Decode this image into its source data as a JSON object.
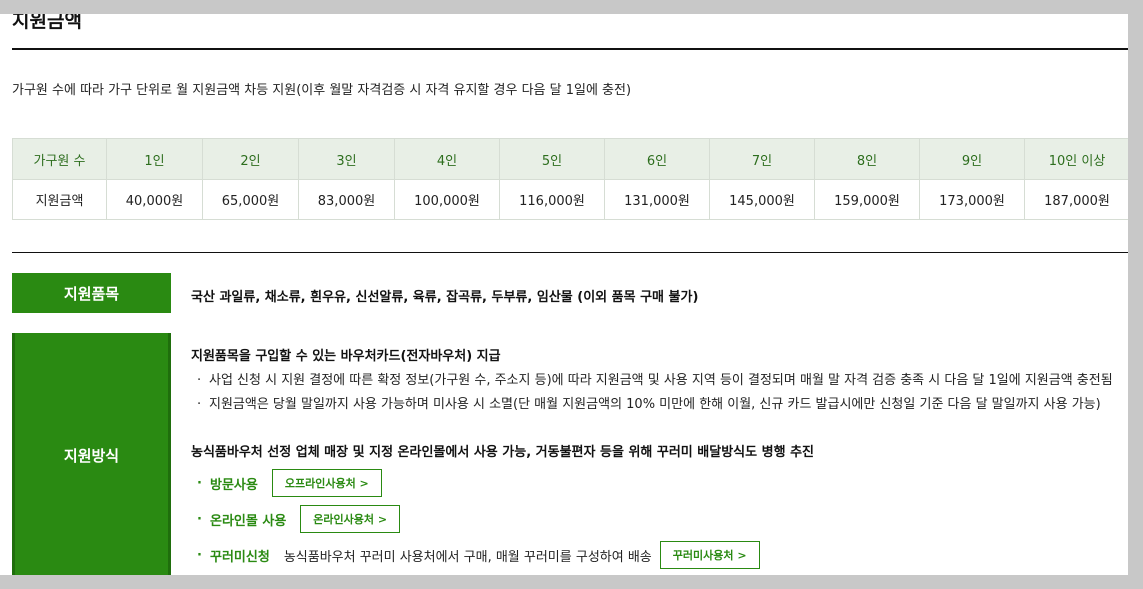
{
  "title": "지원금액",
  "description": "가구원 수에 따라 가구 단위로 월 지원금액 차등 지원(이후 월말 자격검증 시 자격 유지할 경우 다음 달 1일에 충전)",
  "amount_table": {
    "header_label": "가구원 수",
    "row_label": "지원금액",
    "columns": [
      {
        "size": "1인",
        "amount": "40,000원"
      },
      {
        "size": "2인",
        "amount": "65,000원"
      },
      {
        "size": "3인",
        "amount": "83,000원"
      },
      {
        "size": "4인",
        "amount": "100,000원"
      },
      {
        "size": "5인",
        "amount": "116,000원"
      },
      {
        "size": "6인",
        "amount": "131,000원"
      },
      {
        "size": "7인",
        "amount": "145,000원"
      },
      {
        "size": "8인",
        "amount": "159,000원"
      },
      {
        "size": "9인",
        "amount": "173,000원"
      },
      {
        "size": "10인 이상",
        "amount": "187,000원"
      }
    ]
  },
  "items": {
    "label": "지원품목",
    "text": "국산 과일류, 채소류, 흰우유, 신선알류, 육류, 잡곡류, 두부류, 임산물 (이외 품목 구매 불가)"
  },
  "method": {
    "label": "지원방식",
    "heading1": "지원품목을 구입할 수 있는 바우처카드(전자바우처) 지급",
    "bullets": [
      "사업 신청 시 지원 결정에 따른 확정 정보(가구원 수, 주소지 등)에 따라 지원금액 및 사용 지역 등이 결정되며 매월 말 자격 검증 충족 시 다음 달 1일에 지원금액 충전됨",
      "지원금액은 당월 말일까지 사용 가능하며 미사용 시 소멸(단 매월 지원금액의 10% 미만에 한해 이월, 신규 카드 발급시에만 신청일 기준 다음 달 말일까지 사용 가능)"
    ],
    "bullet_mark": "·",
    "heading2": "농식품바우처 선정 업체 매장 및 지정 온라인몰에서 사용 가능, 거동불편자 등을 위해 꾸러미 배달방식도 병행 추진",
    "uses": [
      {
        "label": "방문사용",
        "desc": "",
        "button": "오프라인사용처 >"
      },
      {
        "label": "온라인몰 사용",
        "desc": "",
        "button": "온라인사용처 >"
      },
      {
        "label": "꾸러미신청",
        "desc": "농식품바우처 꾸러미 사용처에서 구매, 매월 꾸러미를 구성하여 배송",
        "button": "꾸러미사용처 >"
      }
    ]
  },
  "colors": {
    "accent_green": "#2a8a12",
    "table_header_bg": "#e8efe6",
    "table_header_text": "#2d6e1e"
  }
}
